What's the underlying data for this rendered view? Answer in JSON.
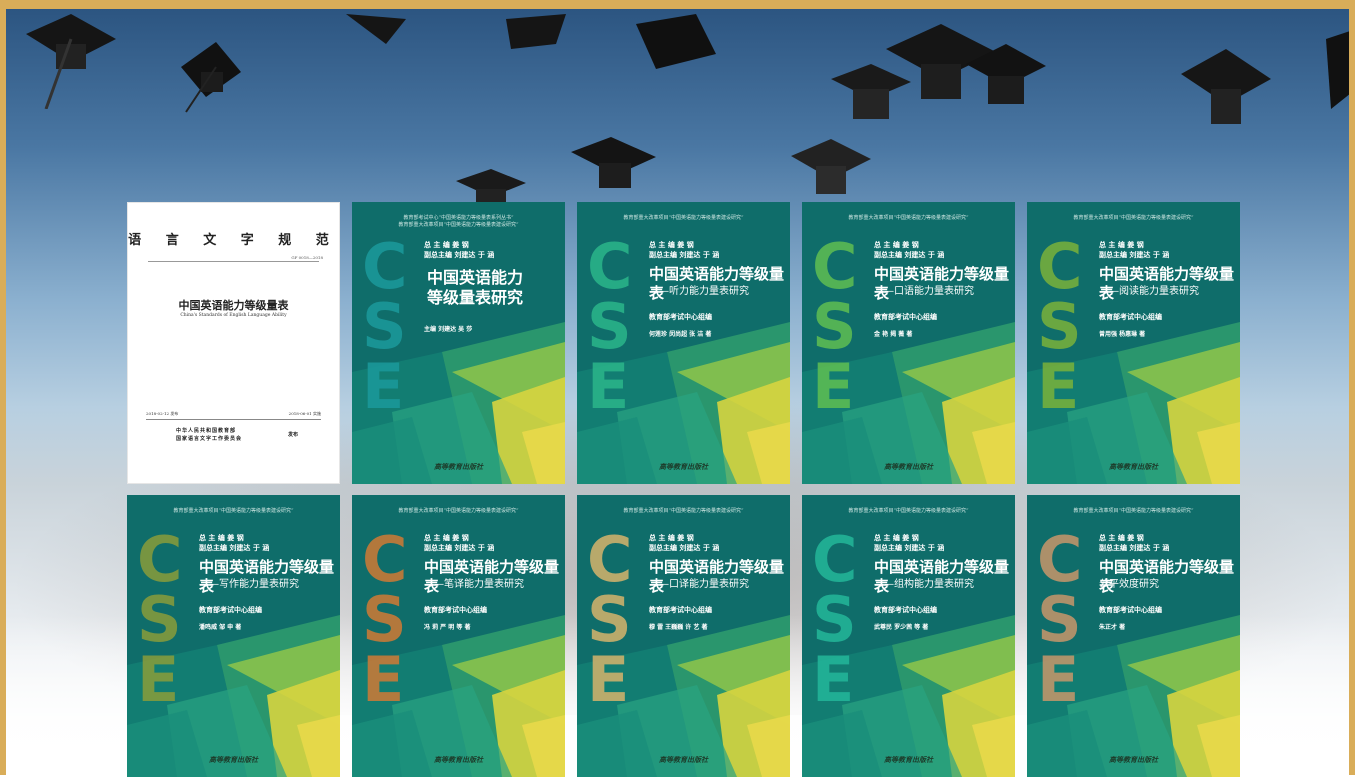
{
  "standard": {
    "header": "语 言 文 字 规 范",
    "code": "GF 0018—2018",
    "title": "中国英语能力等级量表",
    "title_en": "China's Standards of English Language Ability",
    "date_published": "2018-02-12 发布",
    "date_effective": "2018-06-01 实施",
    "issuer_line1": "中华人民共和国教育部",
    "issuer_line2": "国家语言文字工作委员会",
    "issue_label": "发布"
  },
  "books": [
    {
      "series": "教育部考试中心“中国英语能力等级量表系列丛书”\n教育部重大改革项目“中国英语能力等级量表建设研究”",
      "editors": "总 主 编  姜  钢\n副总主编  刘建达  于  涵",
      "title": "中国英语能力\n等级量表研究",
      "subtitle": "",
      "org": "",
      "authors": "主编  刘建达  吴  莎",
      "cse": "CSE",
      "cse_color": "#1b9a9c",
      "publisher": "高等教育出版社"
    },
    {
      "series": "教育部重大改革项目“中国英语能力等级量表建设研究”",
      "editors": "总 主 编  姜  钢\n副总主编  刘建达  于  涵",
      "title": "中国英语能力等级量表",
      "subtitle": "——听力能力量表研究",
      "org": "教育部考试中心组编",
      "authors": "何莲珍  闵尚超  张  洁  著",
      "cse": "CSE",
      "cse_color": "#2bb68a",
      "publisher": "高等教育出版社"
    },
    {
      "series": "教育部重大改革项目“中国英语能力等级量表建设研究”",
      "editors": "总 主 编  姜  钢\n副总主编  刘建达  于  涵",
      "title": "中国英语能力等级量表",
      "subtitle": "——口语能力量表研究",
      "org": "教育部考试中心组编",
      "authors": "金  艳  揭  薇  著",
      "cse": "CSE",
      "cse_color": "#5fbf52",
      "publisher": "高等教育出版社"
    },
    {
      "series": "教育部重大改革项目“中国英语能力等级量表建设研究”",
      "editors": "总 主 编  姜  钢\n副总主编  刘建达  于  涵",
      "title": "中国英语能力等级量表",
      "subtitle": "——阅读能力量表研究",
      "org": "教育部考试中心组编",
      "authors": "曾用强  杨惠琳  著",
      "cse": "CSE",
      "cse_color": "#7ab23a",
      "publisher": "高等教育出版社"
    },
    {
      "series": "教育部重大改革项目“中国英语能力等级量表建设研究”",
      "editors": "总 主 编  姜  钢\n副总主编  刘建达  于  涵",
      "title": "中国英语能力等级量表",
      "subtitle": "——写作能力量表研究",
      "org": "教育部考试中心组编",
      "authors": "潘鸣威  邹  申  著",
      "cse": "CSE",
      "cse_color": "#8a9d3a",
      "publisher": "高等教育出版社"
    },
    {
      "series": "教育部重大改革项目“中国英语能力等级量表建设研究”",
      "editors": "总 主 编  姜  钢\n副总主编  刘建达  于  涵",
      "title": "中国英语能力等级量表",
      "subtitle": "——笔译能力量表研究",
      "org": "教育部考试中心组编",
      "authors": "冯  莉  严  明  等  著",
      "cse": "CSE",
      "cse_color": "#d07a35",
      "publisher": "高等教育出版社"
    },
    {
      "series": "教育部重大改革项目“中国英语能力等级量表建设研究”",
      "editors": "总 主 编  姜  钢\n副总主编  刘建达  于  涵",
      "title": "中国英语能力等级量表",
      "subtitle": "——口译能力量表研究",
      "org": "教育部考试中心组编",
      "authors": "穆  雷  王巍巍  许  艺  著",
      "cse": "CSE",
      "cse_color": "#d6b46c",
      "publisher": "高等教育出版社"
    },
    {
      "series": "教育部重大改革项目“中国英语能力等级量表建设研究”",
      "editors": "总 主 编  姜  钢\n副总主编  刘建达  于  涵",
      "title": "中国英语能力等级量表",
      "subtitle": "——组构能力量表研究",
      "org": "教育部考试中心组编",
      "authors": "武尊民  罗少茜  等  著",
      "cse": "CSE",
      "cse_color": "#23b79a",
      "publisher": "高等教育出版社"
    },
    {
      "series": "教育部重大改革项目“中国英语能力等级量表建设研究”",
      "editors": "总 主 编  姜  钢\n副总主编  刘建达  于  涵",
      "title": "中国英语能力等级量表",
      "subtitle": "公平效度研究",
      "org": "教育部考试中心组编",
      "authors": "朱正才  著",
      "cse": "CSE",
      "cse_color": "#c8976a",
      "publisher": "高等教育出版社"
    }
  ]
}
